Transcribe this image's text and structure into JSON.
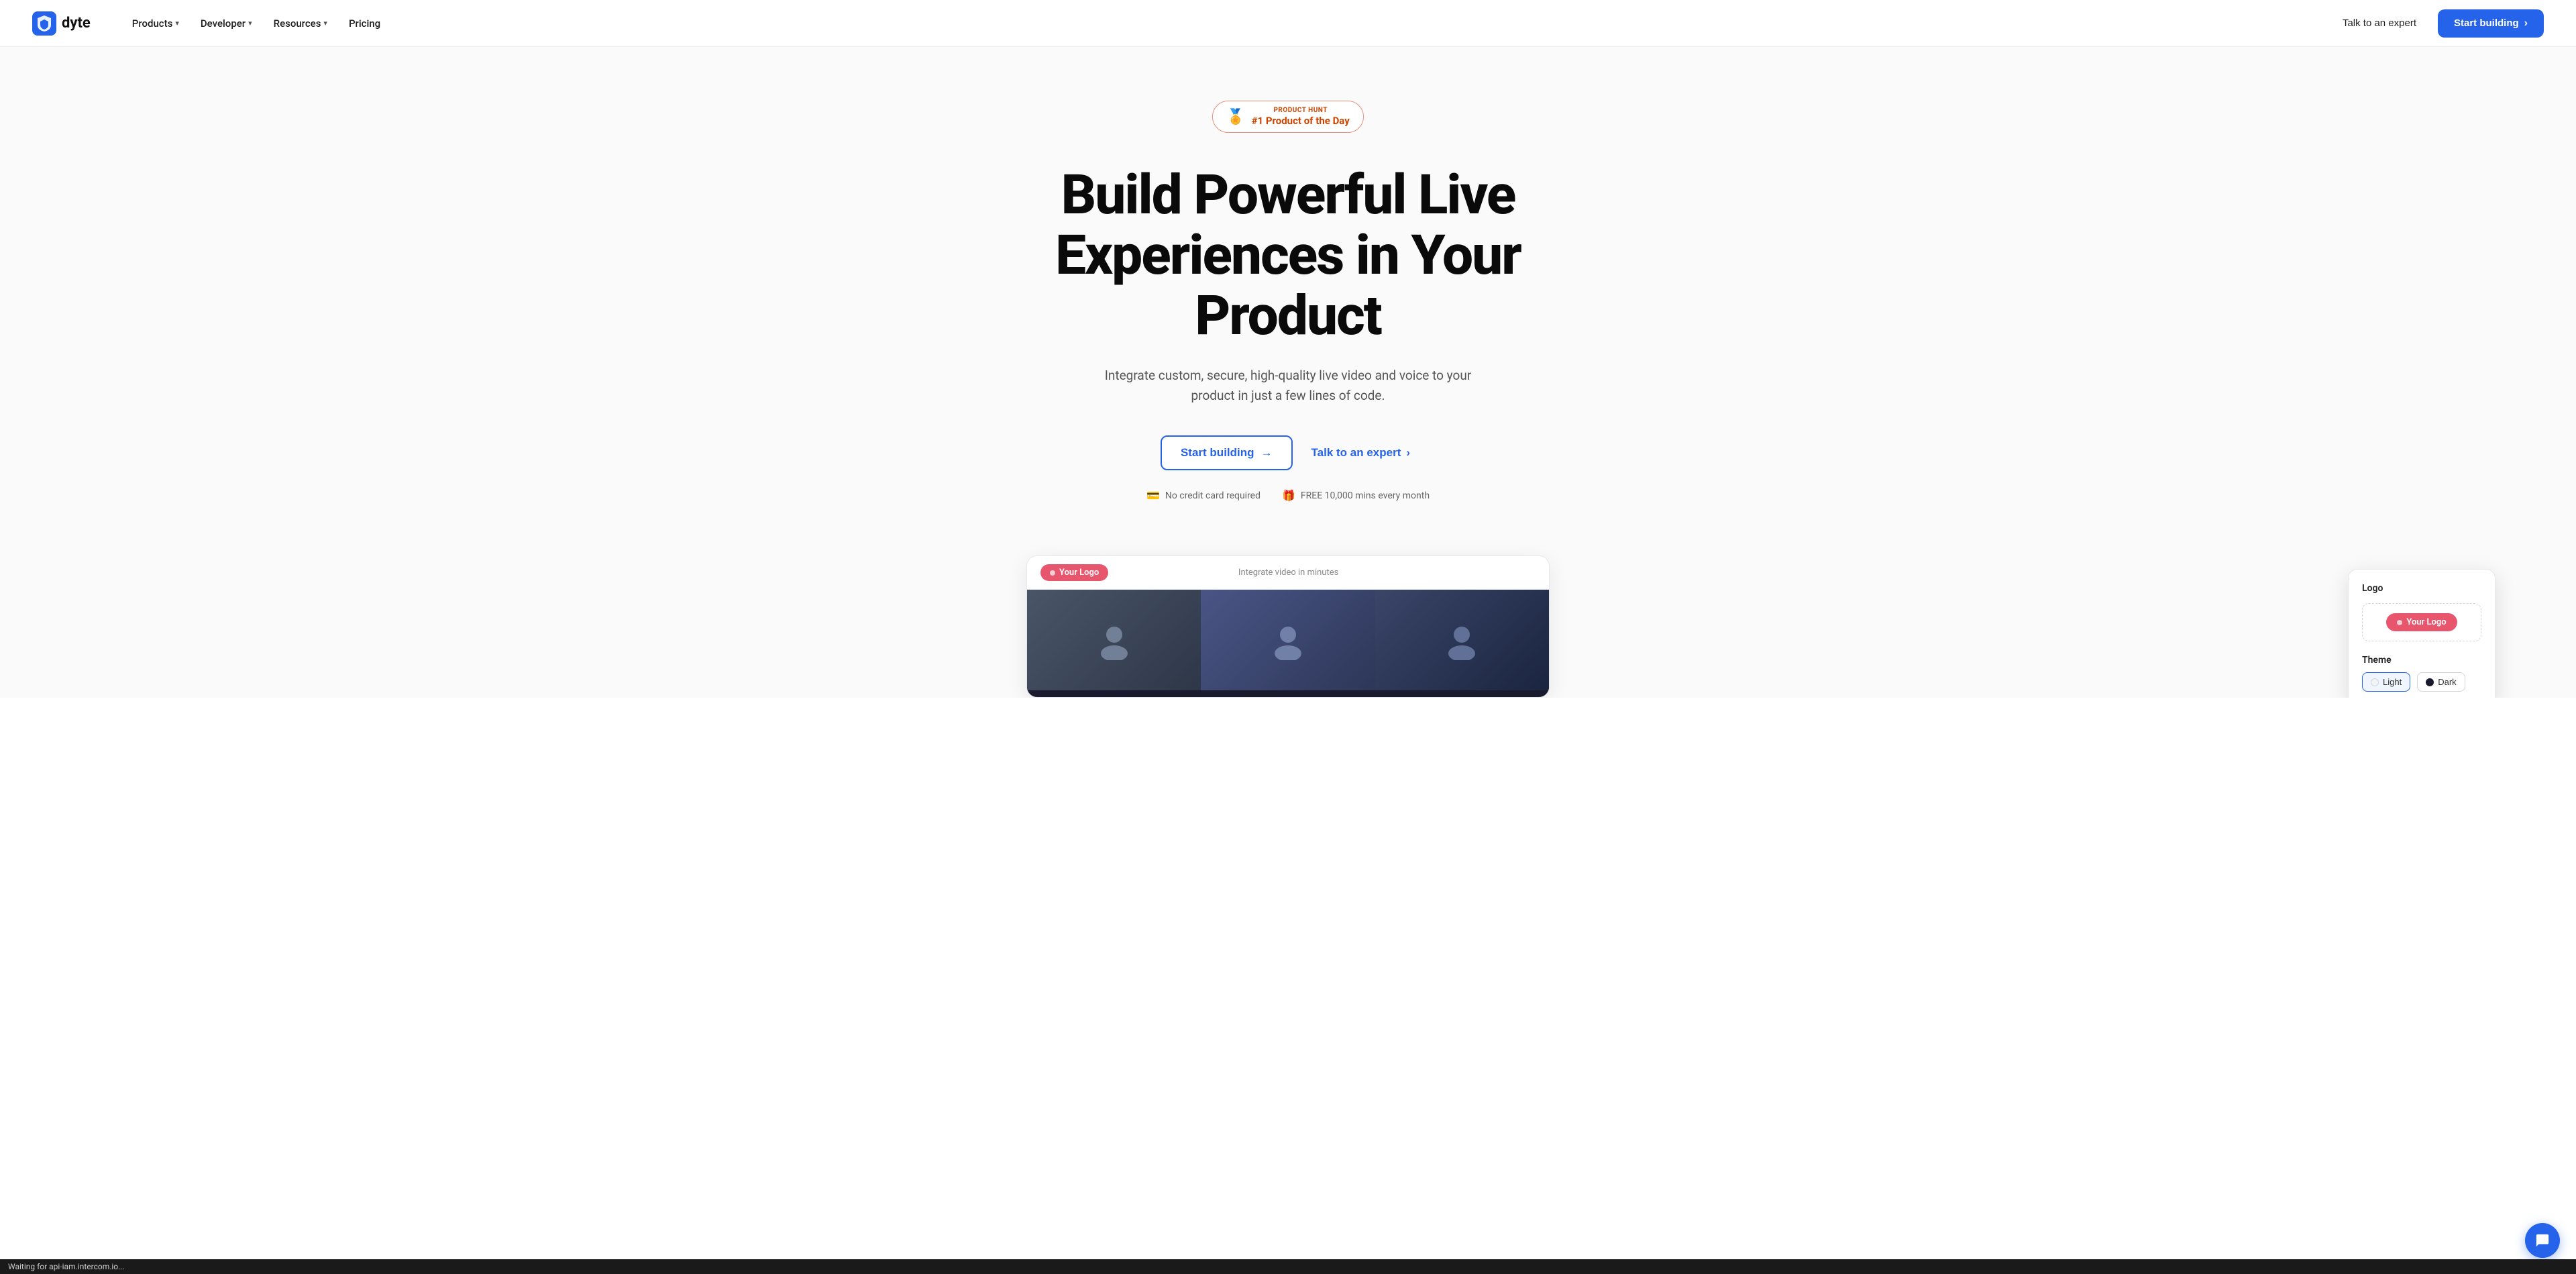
{
  "nav": {
    "logo_text": "dyte",
    "items": [
      {
        "label": "Products",
        "has_chevron": true
      },
      {
        "label": "Developer",
        "has_chevron": true
      },
      {
        "label": "Resources",
        "has_chevron": true
      },
      {
        "label": "Pricing",
        "has_chevron": false
      }
    ],
    "talk_label": "Talk to an expert",
    "start_label": "Start building",
    "start_arrow": "›"
  },
  "hero": {
    "badge": {
      "medal": "🏅",
      "label_small": "PRODUCT HUNT",
      "label_main": "#1 Product of the Day"
    },
    "title_line1": "Build Powerful Live",
    "title_line2": "Experiences in Your Product",
    "subtitle": "Integrate custom, secure, high-quality live video and voice to your product in just a few lines of code.",
    "cta_start": "Start building",
    "cta_start_arrow": "→",
    "cta_talk": "Talk to an expert",
    "cta_talk_arrow": "›",
    "perk1": "No credit card required",
    "perk2": "FREE 10,000 mins every month"
  },
  "demo": {
    "logo_text": "Your Logo",
    "topbar_title": "Integrate video in minutes",
    "customizer": {
      "logo_section": "Logo",
      "logo_pill_text": "Your Logo",
      "theme_section": "Theme",
      "theme_light": "Light",
      "theme_dark": "Dark"
    }
  },
  "status": {
    "text": "Waiting for api-iam.intercom.io..."
  },
  "chat": {
    "icon": "💬"
  }
}
